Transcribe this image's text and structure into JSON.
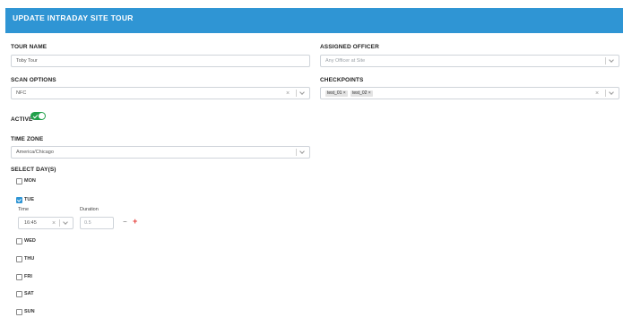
{
  "header": {
    "title": "UPDATE INTRADAY SITE TOUR",
    "color": "#2f95d4"
  },
  "tour_name": {
    "label": "TOUR NAME",
    "value": "Toby Tour"
  },
  "assigned_officer": {
    "label": "ASSIGNED OFFICER",
    "placeholder": "Any Officer at Site"
  },
  "scan_options": {
    "label": "SCAN OPTIONS",
    "value": "NFC"
  },
  "checkpoints": {
    "label": "CHECKPOINTS",
    "tags": [
      "test_01",
      "test_02"
    ]
  },
  "active": {
    "label": "ACTIVE",
    "on": true,
    "color": "#21a04a"
  },
  "time_zone": {
    "label": "TIME ZONE",
    "value": "America/Chicago"
  },
  "days": {
    "label": "SELECT DAY(S)",
    "items": [
      {
        "name": "MON",
        "checked": false
      },
      {
        "name": "TUE",
        "checked": true
      },
      {
        "name": "WED",
        "checked": false
      },
      {
        "name": "THU",
        "checked": false
      },
      {
        "name": "FRI",
        "checked": false
      },
      {
        "name": "SAT",
        "checked": false
      },
      {
        "name": "SUN",
        "checked": false
      }
    ]
  },
  "schedule": {
    "time_label": "Time",
    "duration_label": "Duration",
    "time_value": "16:45",
    "duration_value": "0.5",
    "minus": "−",
    "plus": "+"
  }
}
